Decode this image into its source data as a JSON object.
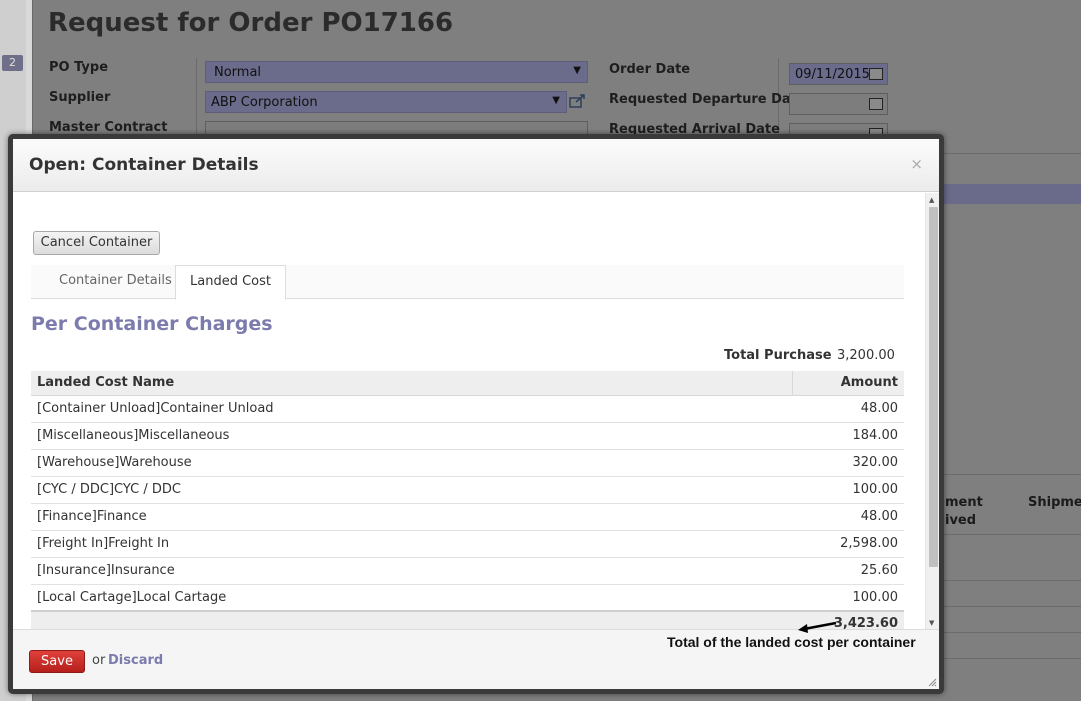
{
  "background": {
    "sidebar_badge": "2",
    "title": "Request for Order",
    "po_number": "PO17166",
    "po_type": {
      "label": "PO Type",
      "value": "Normal"
    },
    "supplier": {
      "label": "Supplier",
      "value": "ABP Corporation"
    },
    "master_contract": {
      "label": "Master Contract",
      "value": ""
    },
    "order_date": {
      "label": "Order Date",
      "value": "09/11/2015"
    },
    "requested_departure_date": {
      "label": "Requested Departure Date",
      "value": ""
    },
    "requested_arrival_date": {
      "label": "Requested Arrival Date",
      "value": ""
    },
    "columns": {
      "shipment_received_partial_1": "ment",
      "shipment_received_partial_2": "ived",
      "shipment_partial": "Shipmen"
    }
  },
  "modal": {
    "title": "Open: Container Details",
    "close_glyph": "×",
    "cancel_button": "Cancel Container",
    "tabs": [
      {
        "label": "Container Details",
        "active": false
      },
      {
        "label": "Landed Cost",
        "active": true
      }
    ],
    "section_title": "Per Container Charges",
    "total_purchase": {
      "label": "Total Purchase",
      "value": "3,200.00"
    },
    "table": {
      "headers": {
        "name": "Landed Cost Name",
        "amount": "Amount"
      },
      "rows": [
        {
          "name": "[Container Unload]Container Unload",
          "amount": "48.00"
        },
        {
          "name": "[Miscellaneous]Miscellaneous",
          "amount": "184.00"
        },
        {
          "name": "[Warehouse]Warehouse",
          "amount": "320.00"
        },
        {
          "name": "[CYC / DDC]CYC / DDC",
          "amount": "100.00"
        },
        {
          "name": "[Finance]Finance",
          "amount": "48.00"
        },
        {
          "name": "[Freight In]Freight In",
          "amount": "2,598.00"
        },
        {
          "name": "[Insurance]Insurance",
          "amount": "25.60"
        },
        {
          "name": "[Local Cartage]Local Cartage",
          "amount": "100.00"
        }
      ],
      "total": "3,423.60"
    },
    "footer": {
      "save_button": "Save",
      "or_text": "or",
      "discard_link": "Discard"
    }
  },
  "annotation": {
    "text": "Total of the landed cost per container"
  },
  "colors": {
    "accent": "#7c7bad",
    "save": "#c9302c"
  }
}
